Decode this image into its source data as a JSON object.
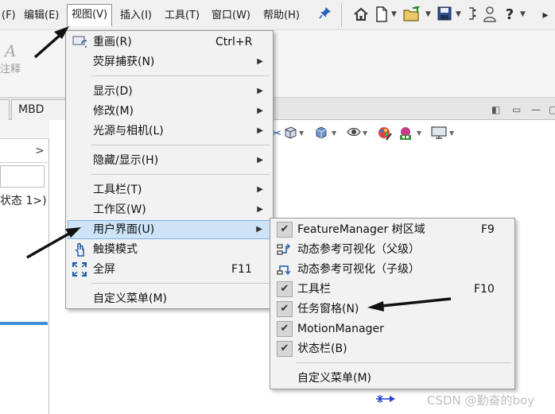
{
  "menubar": {
    "items": [
      "(F)",
      "编辑(E)",
      "视图(V)",
      "插入(I)",
      "工具(T)",
      "窗口(W)",
      "帮助(H)"
    ],
    "pin_icon": "pin-icon",
    "toolbar_icons": [
      "home-icon",
      "new-document-icon",
      "open-folder-icon",
      "save-icon",
      "print-icon",
      "user-icon",
      "help-icon"
    ],
    "help_label": "?"
  },
  "command_manager": {
    "annotate_label": "注释"
  },
  "tabs": {
    "mbd": "MBD Dir"
  },
  "left_panel": {
    "state_text": "状态 1>)"
  },
  "view_menu": {
    "items": [
      {
        "label": "重画(R)",
        "shortcut": "Ctrl+R"
      },
      {
        "label": "荧屏捕获(N)"
      },
      {
        "label": "显示(D)"
      },
      {
        "label": "修改(M)"
      },
      {
        "label": "光源与相机(L)"
      },
      {
        "label": "隐藏/显示(H)"
      },
      {
        "label": "工具栏(T)"
      },
      {
        "label": "工作区(W)"
      },
      {
        "label": "用户界面(U)"
      },
      {
        "label": "触摸模式"
      },
      {
        "label": "全屏",
        "shortcut": "F11"
      },
      {
        "label": "自定义菜单(M)"
      }
    ]
  },
  "ui_submenu": {
    "items": [
      {
        "label": "FeatureManager 树区域",
        "shortcut": "F9",
        "checked": true
      },
      {
        "label": "动态参考可视化（父级）",
        "checked": false
      },
      {
        "label": "动态参考可视化（子级）",
        "checked": false
      },
      {
        "label": "工具栏",
        "shortcut": "F10",
        "checked": true
      },
      {
        "label": "任务窗格(N)",
        "checked": true
      },
      {
        "label": "MotionManager",
        "checked": true
      },
      {
        "label": "状态栏(B)",
        "checked": true
      },
      {
        "label": "自定义菜单(M)"
      }
    ]
  },
  "check_mark": "✔",
  "watermark": "CSDN @勤奋的boy",
  "colors": {
    "highlight": "#cde3f7",
    "accent_blue": "#3d8ed6",
    "arrow": "#111111"
  }
}
